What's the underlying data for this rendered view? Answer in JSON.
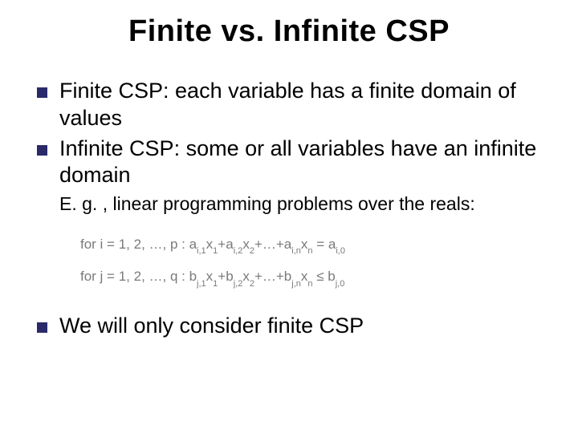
{
  "title": "Finite vs. Infinite CSP",
  "bullets": {
    "b1": "Finite CSP: each variable has a finite domain of values",
    "b2": "Infinite CSP: some or all variables have an infinite domain",
    "b3": "We will only consider finite CSP"
  },
  "subtext": "E. g. , linear programming problems over the reals:",
  "formula": {
    "f1_prefix": "for i = 1, 2, …, p : a",
    "f1_s1": "i,1",
    "f1_x1": "x",
    "f1_s1b": "1",
    "f1_plus1": "+a",
    "f1_s2": "i,2",
    "f1_x2": "x",
    "f1_s2b": "2",
    "f1_mid": "+…+a",
    "f1_s3": "i,n",
    "f1_x3": "x",
    "f1_s3b": "n",
    "f1_eq": " = a",
    "f1_rhs": "i,0",
    "f2_prefix": "for j = 1, 2, …, q : b",
    "f2_s1": "j,1",
    "f2_x1": "x",
    "f2_s1b": "1",
    "f2_plus1": "+b",
    "f2_s2": "j,2",
    "f2_x2": "x",
    "f2_s2b": "2",
    "f2_mid": "+…+b",
    "f2_s3": "j,n",
    "f2_x3": "x",
    "f2_s3b": "n",
    "f2_leq": " ≤ b",
    "f2_rhs": "j,0"
  }
}
